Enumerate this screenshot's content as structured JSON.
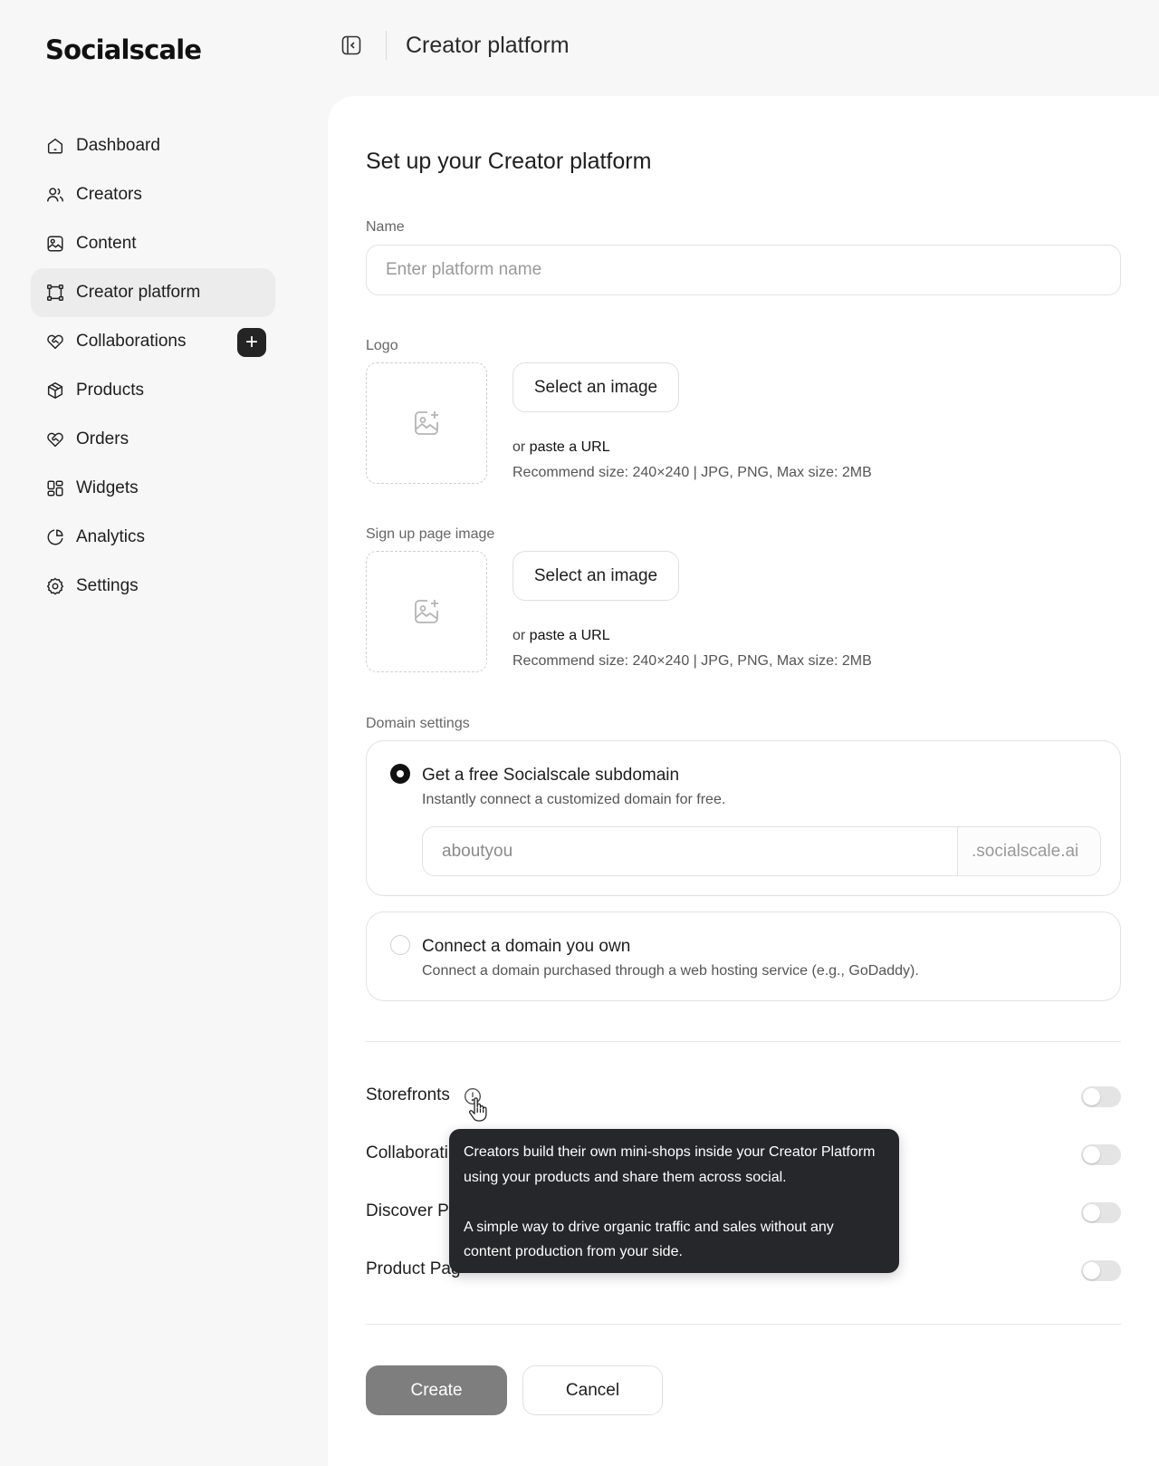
{
  "app": {
    "brand": "Socialscale"
  },
  "header": {
    "title": "Creator platform"
  },
  "sidebar": {
    "items": [
      {
        "label": "Dashboard",
        "icon": "home-icon"
      },
      {
        "label": "Creators",
        "icon": "users-icon"
      },
      {
        "label": "Content",
        "icon": "image-icon"
      },
      {
        "label": "Creator platform",
        "icon": "frame-icon",
        "active": true
      },
      {
        "label": "Collaborations",
        "icon": "handshake-icon",
        "has_add_button": true
      },
      {
        "label": "Products",
        "icon": "box-icon"
      },
      {
        "label": "Orders",
        "icon": "handshake-icon"
      },
      {
        "label": "Widgets",
        "icon": "grid-icon"
      },
      {
        "label": "Analytics",
        "icon": "pie-chart-icon"
      },
      {
        "label": "Settings",
        "icon": "gear-icon"
      }
    ],
    "add_button_glyph": "+"
  },
  "form": {
    "title": "Set up your Creator platform",
    "name": {
      "label": "Name",
      "placeholder": "Enter platform name",
      "value": ""
    },
    "logo": {
      "label": "Logo",
      "select_label": "Select an image",
      "paste_prefix": "or ",
      "paste_link": "paste a URL",
      "hint": "Recommend size: 240×240 | JPG, PNG, Max size: 2MB"
    },
    "signup_image": {
      "label": "Sign up page image",
      "select_label": "Select an image",
      "paste_prefix": "or ",
      "paste_link": "paste a URL",
      "hint": "Recommend size: 240×240 | JPG, PNG, Max size: 2MB"
    },
    "domain": {
      "label": "Domain settings",
      "options": [
        {
          "title": "Get a free Socialscale subdomain",
          "description": "Instantly connect a customized domain for free.",
          "selected": true,
          "subdomain_value": "aboutyou",
          "suffix": ".socialscale.ai"
        },
        {
          "title": "Connect a domain you own",
          "description": "Connect a domain purchased through a web hosting service (e.g., GoDaddy).",
          "selected": false
        }
      ]
    },
    "features": [
      {
        "label": "Storefronts",
        "enabled": false
      },
      {
        "label": "Collaborati",
        "enabled": false
      },
      {
        "label": "Discover P",
        "enabled": false
      },
      {
        "label": "Product Pag",
        "enabled": false
      }
    ],
    "tooltip": {
      "p1": "Creators build their own mini-shops inside your Creator Platform using your products and share them across social.",
      "p2": "A simple way to drive organic traffic and sales without any content production from your side."
    },
    "actions": {
      "create": "Create",
      "cancel": "Cancel"
    }
  },
  "colors": {
    "accent_dark": "#111111",
    "create_disabled": "#7e7e7e",
    "tooltip_bg": "#26272b"
  }
}
